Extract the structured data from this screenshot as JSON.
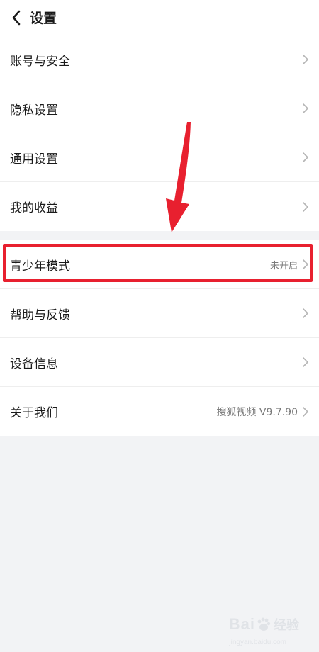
{
  "header": {
    "title": "设置"
  },
  "group1": {
    "items": [
      {
        "label": "账号与安全"
      },
      {
        "label": "隐私设置"
      },
      {
        "label": "通用设置"
      },
      {
        "label": "我的收益"
      }
    ]
  },
  "group2": {
    "items": [
      {
        "label": "青少年模式",
        "value": "未开启"
      },
      {
        "label": "帮助与反馈"
      },
      {
        "label": "设备信息"
      },
      {
        "label": "关于我们",
        "value": "搜狐视频 V9.7.90"
      }
    ]
  },
  "watermark": {
    "brand": "Bai",
    "brand2": "经验",
    "url": "jingyan.baidu.com"
  },
  "colors": {
    "annotation_red": "#e8202f",
    "background": "#f2f3f5",
    "secondary_text": "#7a7a7a"
  },
  "icons": {
    "back": "chevron-left-icon",
    "row_arrow": "chevron-right-icon",
    "annotation": "red-arrow-icon"
  }
}
